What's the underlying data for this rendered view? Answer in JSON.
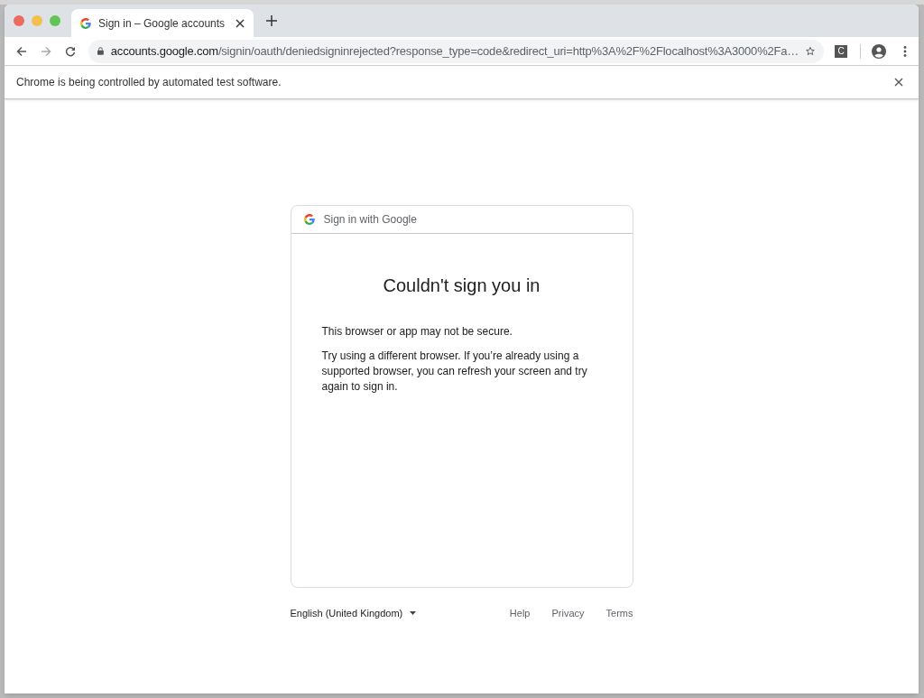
{
  "tab": {
    "title": "Sign in – Google accounts",
    "selected": true
  },
  "toolbar": {
    "url_host": "accounts.google.com",
    "url_rest": "/signin/oauth/deniedsigninrejected?response_type=code&redirect_uri=http%3A%2F%2Flocalhost%3A3000%2Fa…",
    "extension_label": "C"
  },
  "infobar": {
    "message": "Chrome is being controlled by automated test software."
  },
  "card": {
    "header": "Sign in with Google",
    "title": "Couldn't sign you in",
    "paragraphs": [
      "This browser or app may not be secure.",
      "Try using a different browser. If you’re already using a supported browser, you can refresh your screen and try again to sign in."
    ]
  },
  "footer": {
    "language": "English (United Kingdom)",
    "links": [
      "Help",
      "Privacy",
      "Terms"
    ]
  }
}
